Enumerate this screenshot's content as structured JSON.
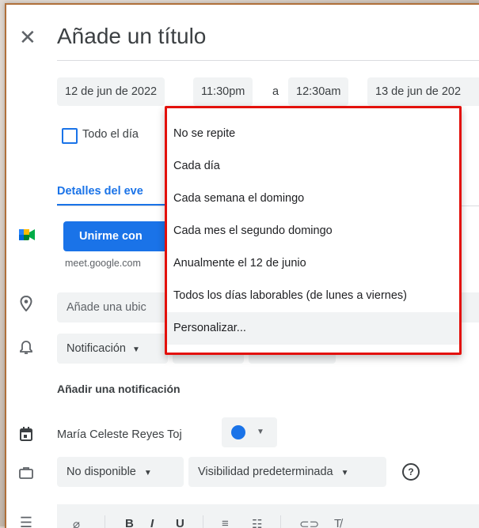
{
  "header": {
    "close_icon": "close-icon",
    "title_placeholder": "Añade un título"
  },
  "datetime": {
    "start_date": "12 de jun de 2022",
    "start_time": "11:30pm",
    "separator": "a",
    "end_time": "12:30am",
    "end_date": "13 de jun de 202"
  },
  "all_day": {
    "label": "Todo el día",
    "checked": false
  },
  "tabs": {
    "details": "Detalles del eve"
  },
  "meet": {
    "button_label": "Unirme con",
    "link_text": "meet.google.com",
    "icon": "google-meet-icon"
  },
  "location": {
    "placeholder": "Añade una ubic",
    "icon": "location-pin-icon"
  },
  "notification": {
    "label": "Notificación",
    "icon": "bell-icon",
    "add_label": "Añadir una notificación"
  },
  "calendar": {
    "owner": "María Celeste Reyes Toj",
    "color": "#1a73e8",
    "icon": "calendar-icon"
  },
  "availability": {
    "status": "No disponible",
    "visibility": "Visibilidad predeterminada",
    "icon": "briefcase-icon",
    "help_icon": "help-circle-icon"
  },
  "editor_toolbar": {
    "icon": "description-icon",
    "items": [
      "attachment-icon",
      "bold-icon",
      "italic-icon",
      "underline-icon",
      "numbered-list-icon",
      "bulleted-list-icon",
      "link-icon",
      "clear-format-icon"
    ]
  },
  "recurrence_menu": {
    "highlight_color": "#e3100b",
    "options": [
      "No se repite",
      "Cada día",
      "Cada semana el domingo",
      "Cada mes el segundo domingo",
      "Anualmente el 12 de junio",
      "Todos los días laborables (de lunes a viernes)",
      "Personalizar..."
    ],
    "hovered_index": 6
  }
}
